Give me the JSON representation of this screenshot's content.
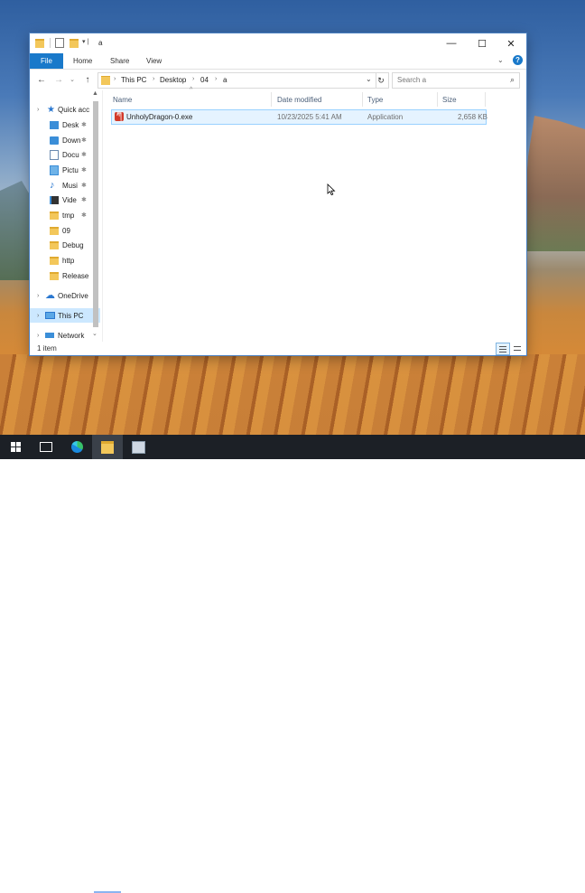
{
  "window": {
    "title": "a",
    "controls": {
      "minimize": "—",
      "maximize": "☐",
      "close": "✕"
    }
  },
  "ribbon": {
    "tabs": [
      {
        "label": "File"
      },
      {
        "label": "Home"
      },
      {
        "label": "Share"
      },
      {
        "label": "View"
      }
    ],
    "help": "?"
  },
  "address": {
    "crumbs": [
      "This PC",
      "Desktop",
      "04",
      "a"
    ],
    "search_placeholder": "Search a"
  },
  "nav_pane": {
    "items": [
      {
        "label": "Quick access",
        "display": "Quick acc",
        "icon": "star-icon"
      },
      {
        "label": "Desktop",
        "display": "Desk",
        "icon": "desktop-icon",
        "pinned": true
      },
      {
        "label": "Downloads",
        "display": "Down",
        "icon": "download-icon",
        "pinned": true
      },
      {
        "label": "Documents",
        "display": "Docu",
        "icon": "document-icon",
        "pinned": true
      },
      {
        "label": "Pictures",
        "display": "Pictu",
        "icon": "picture-icon",
        "pinned": true
      },
      {
        "label": "Music",
        "display": "Musi",
        "icon": "music-icon",
        "pinned": true
      },
      {
        "label": "Videos",
        "display": "Vide",
        "icon": "video-icon",
        "pinned": true
      },
      {
        "label": "tmp",
        "display": "tmp",
        "icon": "folder-icon",
        "pinned": true
      },
      {
        "label": "09",
        "display": "09",
        "icon": "folder-icon"
      },
      {
        "label": "Debug",
        "display": "Debug",
        "icon": "folder-icon"
      },
      {
        "label": "http",
        "display": "http",
        "icon": "folder-icon"
      },
      {
        "label": "Release",
        "display": "Release",
        "icon": "folder-icon"
      },
      {
        "label": "OneDrive",
        "display": "OneDrive",
        "icon": "onedrive-icon"
      },
      {
        "label": "This PC",
        "display": "This PC",
        "icon": "computer-icon",
        "selected": true
      },
      {
        "label": "Network",
        "display": "Network",
        "icon": "network-icon"
      }
    ],
    "pin_glyph": "✱"
  },
  "file_list": {
    "columns": [
      "Name",
      "Date modified",
      "Type",
      "Size"
    ],
    "rows": [
      {
        "name": "UnholyDragon-0.exe",
        "date": "10/23/2025 5:41 AM",
        "type": "Application",
        "size": "2,658 KB"
      }
    ]
  },
  "status": {
    "text": "1 item"
  },
  "taskbar": {
    "icons": [
      "windows-start-icon",
      "task-view-icon",
      "edge-icon",
      "file-explorer-icon",
      "app-icon"
    ]
  }
}
